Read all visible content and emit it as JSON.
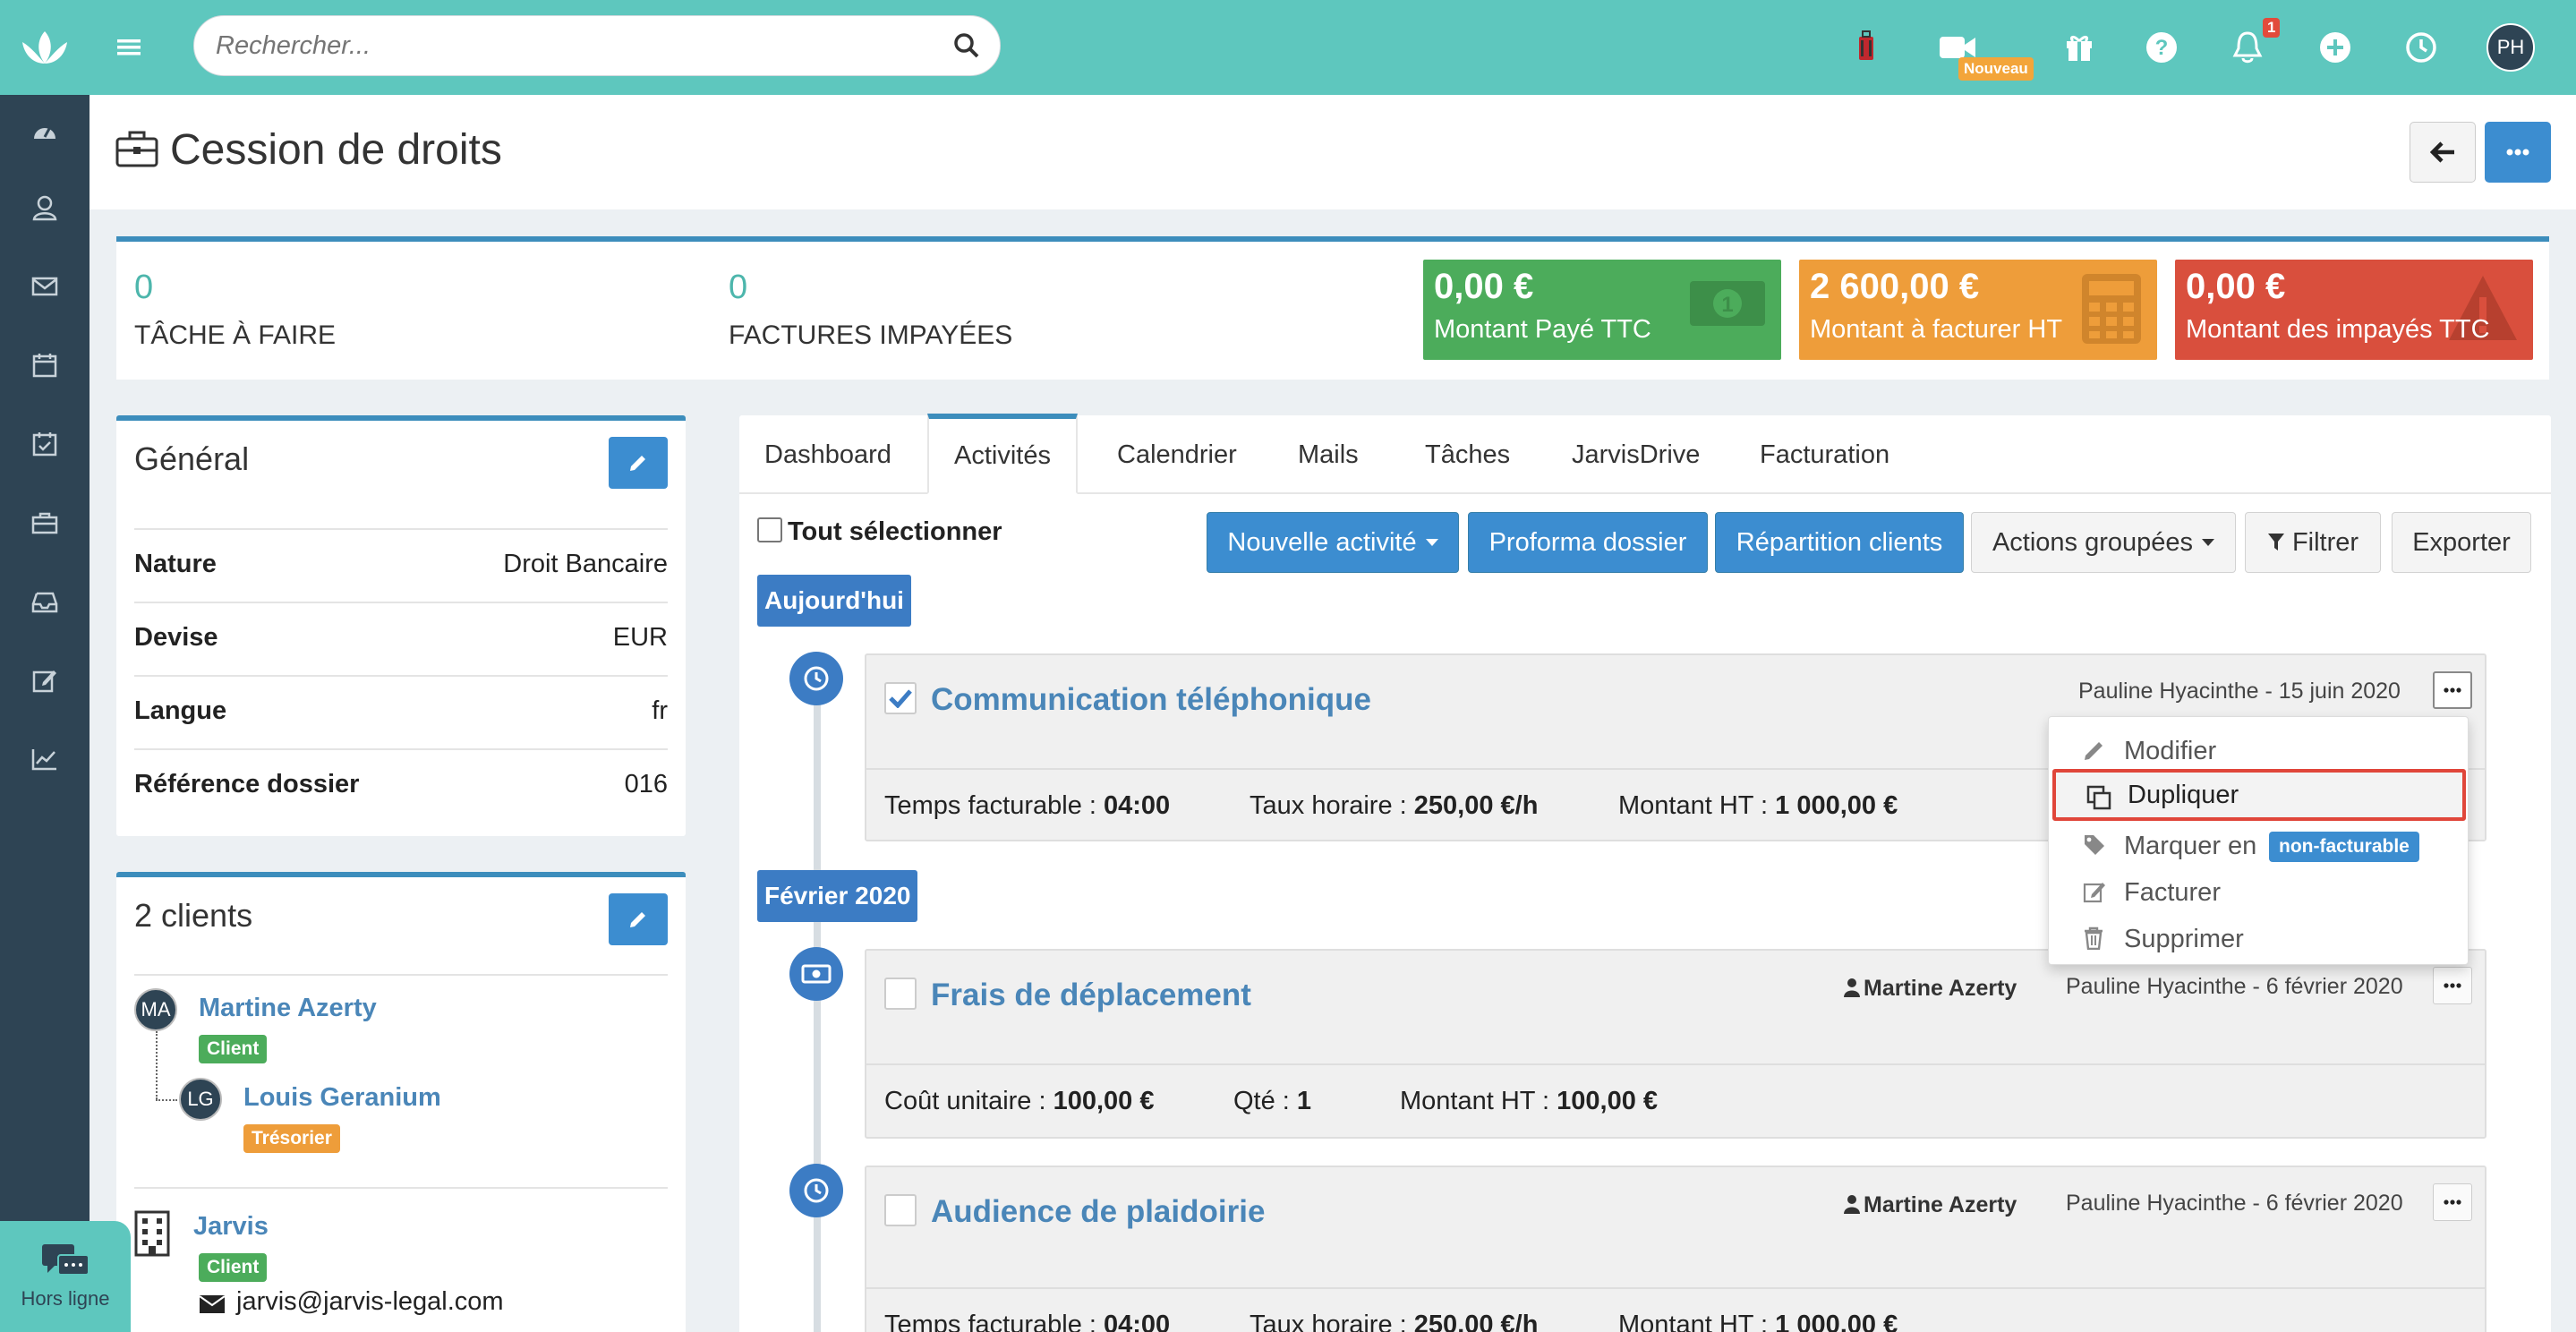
{
  "search": {
    "placeholder": "Rechercher..."
  },
  "topbar": {
    "nouveau_badge": "Nouveau",
    "notification_count": "1",
    "user_initials": "PH"
  },
  "page": {
    "title": "Cession de droits"
  },
  "kpi": {
    "tasks_count": "0",
    "tasks_label": "TÂCHE À FAIRE",
    "invoices_count": "0",
    "invoices_label": "FACTURES IMPAYÉES",
    "paid": {
      "amount": "0,00 €",
      "label": "Montant Payé TTC",
      "color": "#4cac5b"
    },
    "to_invoice": {
      "amount": "2 600,00 €",
      "label": "Montant à facturer HT",
      "color": "#ee9d3a"
    },
    "unpaid": {
      "amount": "0,00 €",
      "label": "Montant des impayés TTC",
      "color": "#d94f3d"
    }
  },
  "general": {
    "title": "Général",
    "rows": [
      {
        "label": "Nature",
        "value": "Droit Bancaire"
      },
      {
        "label": "Devise",
        "value": "EUR"
      },
      {
        "label": "Langue",
        "value": "fr"
      },
      {
        "label": "Référence dossier",
        "value": "016"
      }
    ]
  },
  "clients": {
    "title": "2 clients",
    "items": [
      {
        "initials": "MA",
        "name": "Martine Azerty",
        "role": "Client",
        "role_color": "#4cac5b"
      },
      {
        "initials": "LG",
        "name": "Louis Geranium",
        "role": "Trésorier",
        "role_color": "#ee9d3a"
      }
    ],
    "company": {
      "name": "Jarvis",
      "role": "Client",
      "email": "jarvis@jarvis-legal.com"
    }
  },
  "tabs": [
    "Dashboard",
    "Activités",
    "Calendrier",
    "Mails",
    "Tâches",
    "JarvisDrive",
    "Facturation"
  ],
  "toolbar": {
    "select_all": "Tout sélectionner",
    "new_activity": "Nouvelle activité",
    "proforma": "Proforma dossier",
    "repartition": "Répartition clients",
    "grouped_actions": "Actions groupées",
    "filter": "Filtrer",
    "export": "Exporter"
  },
  "groups": {
    "today": "Aujourd'hui",
    "feb": "Février 2020"
  },
  "activities": [
    {
      "title": "Communication téléphonique",
      "checked": true,
      "meta": "Pauline Hyacinthe - 15 juin 2020",
      "fields": [
        {
          "k": "Temps facturable : ",
          "v": "04:00"
        },
        {
          "k": "Taux horaire : ",
          "v": "250,00 €/h"
        },
        {
          "k": "Montant HT : ",
          "v": "1 000,00 €"
        }
      ]
    },
    {
      "title": "Frais de déplacement",
      "checked": false,
      "person": "Martine Azerty",
      "meta": "Pauline Hyacinthe - 6 février 2020",
      "fields": [
        {
          "k": "Coût unitaire : ",
          "v": "100,00 €"
        },
        {
          "k": "Qté : ",
          "v": "1"
        },
        {
          "k": "Montant HT : ",
          "v": "100,00 €"
        }
      ]
    },
    {
      "title": "Audience de plaidoirie",
      "checked": false,
      "person": "Martine Azerty",
      "meta": "Pauline Hyacinthe - 6 février 2020",
      "fields": [
        {
          "k": "Temps facturable : ",
          "v": "04:00"
        },
        {
          "k": "Taux horaire : ",
          "v": "250,00 €/h"
        },
        {
          "k": "Montant HT : ",
          "v": "1 000,00 €"
        }
      ]
    }
  ],
  "dropdown": {
    "modifier": "Modifier",
    "dupliquer": "Dupliquer",
    "marquer": "Marquer en",
    "non_facturable": "non-facturable",
    "facturer": "Facturer",
    "supprimer": "Supprimer"
  },
  "offline": {
    "label": "Hors ligne"
  }
}
